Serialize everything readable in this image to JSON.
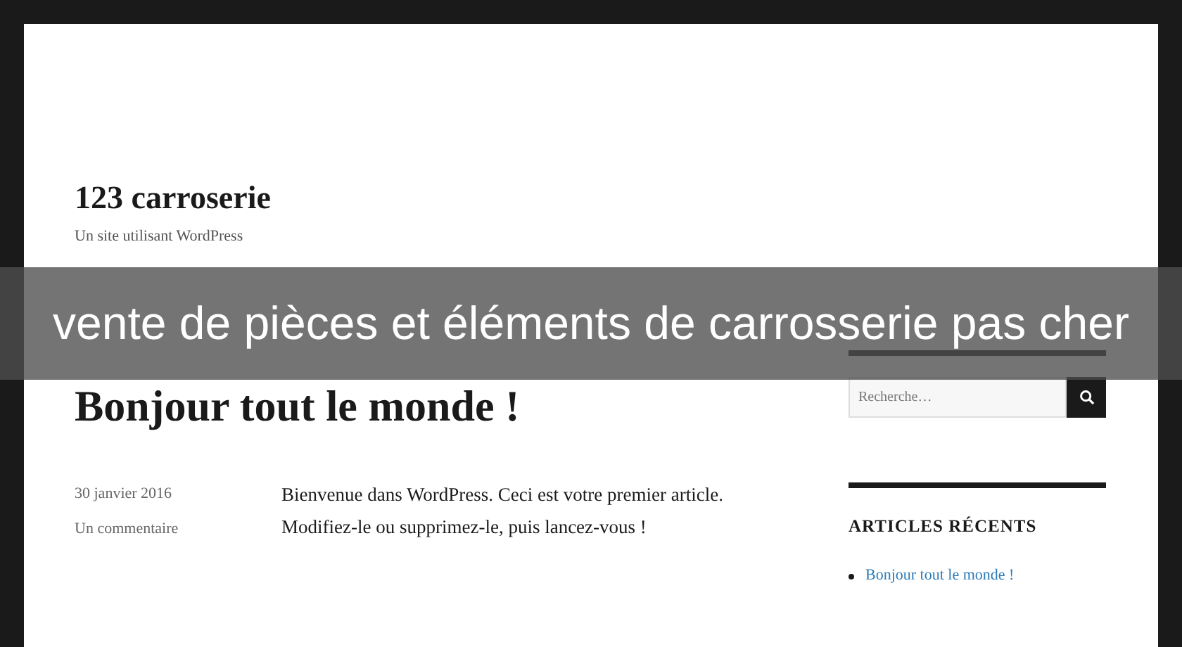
{
  "site": {
    "title": "123 carroserie",
    "tagline": "Un site utilisant WordPress"
  },
  "banner": {
    "text": "vente de pièces et éléments de carrosserie pas cher"
  },
  "post": {
    "title": "Bonjour tout le monde !",
    "date": "30 janvier 2016",
    "comments": "Un commentaire",
    "paragraphs": [
      "Bienvenue dans WordPress. Ceci est votre premier article.",
      "Modifiez-le ou supprimez-le, puis lancez-vous !"
    ]
  },
  "sidebar": {
    "search": {
      "placeholder": "Recherche…"
    },
    "recent_heading": "ARTICLES RÉCENTS",
    "recent_posts": [
      "Bonjour tout le monde !"
    ]
  }
}
